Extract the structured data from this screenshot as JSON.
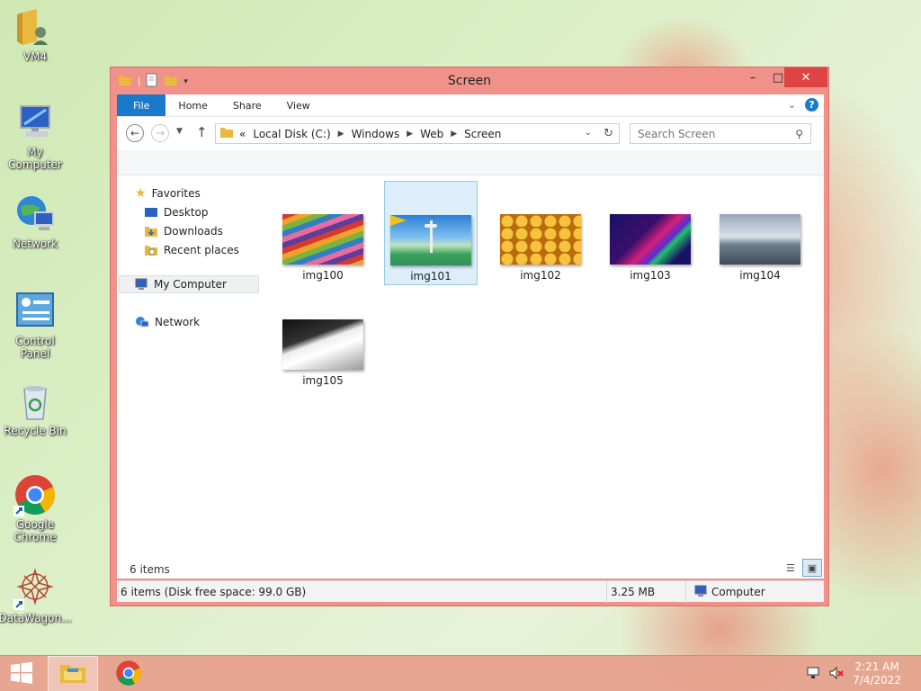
{
  "desktop": {
    "icons": [
      {
        "label": "VM4",
        "icon": "user-folder-icon"
      },
      {
        "label": "My Computer",
        "icon": "computer-icon"
      },
      {
        "label": "Network",
        "icon": "network-icon"
      },
      {
        "label": "Control Panel",
        "icon": "control-panel-icon"
      },
      {
        "label": "Recycle Bin",
        "icon": "recycle-bin-icon"
      },
      {
        "label": "Google Chrome",
        "icon": "chrome-icon"
      },
      {
        "label": "DataWagon...",
        "icon": "datawagon-icon"
      }
    ]
  },
  "window": {
    "title": "Screen",
    "controls": {
      "minimize": "–",
      "maximize": "□",
      "close": "✕"
    },
    "ribbon_tabs": [
      "File",
      "Home",
      "Share",
      "View"
    ],
    "breadcrumb": {
      "overflow": "«",
      "items": [
        "Local Disk (C:)",
        "Windows",
        "Web",
        "Screen"
      ]
    },
    "search": {
      "placeholder": "Search Screen"
    },
    "nav_pane": {
      "favorites": "Favorites",
      "favorite_items": [
        "Desktop",
        "Downloads",
        "Recent places"
      ],
      "computer": "My Computer",
      "network": "Network"
    },
    "files": [
      {
        "name": "img100",
        "selected": false
      },
      {
        "name": "img101",
        "selected": true
      },
      {
        "name": "img102",
        "selected": false
      },
      {
        "name": "img103",
        "selected": false
      },
      {
        "name": "img104",
        "selected": false
      },
      {
        "name": "img105",
        "selected": false
      }
    ],
    "item_count": "6 items",
    "status": {
      "summary": "6 items (Disk free space: 99.0 GB)",
      "size": "3.25 MB",
      "location": "Computer"
    }
  },
  "taskbar": {
    "time": "2:21 AM",
    "date": "7/4/2022"
  },
  "colors": {
    "window_frame": "#f0918a",
    "file_tab": "#1979ca",
    "close_button": "#e04343",
    "selection": "#dceefa"
  }
}
